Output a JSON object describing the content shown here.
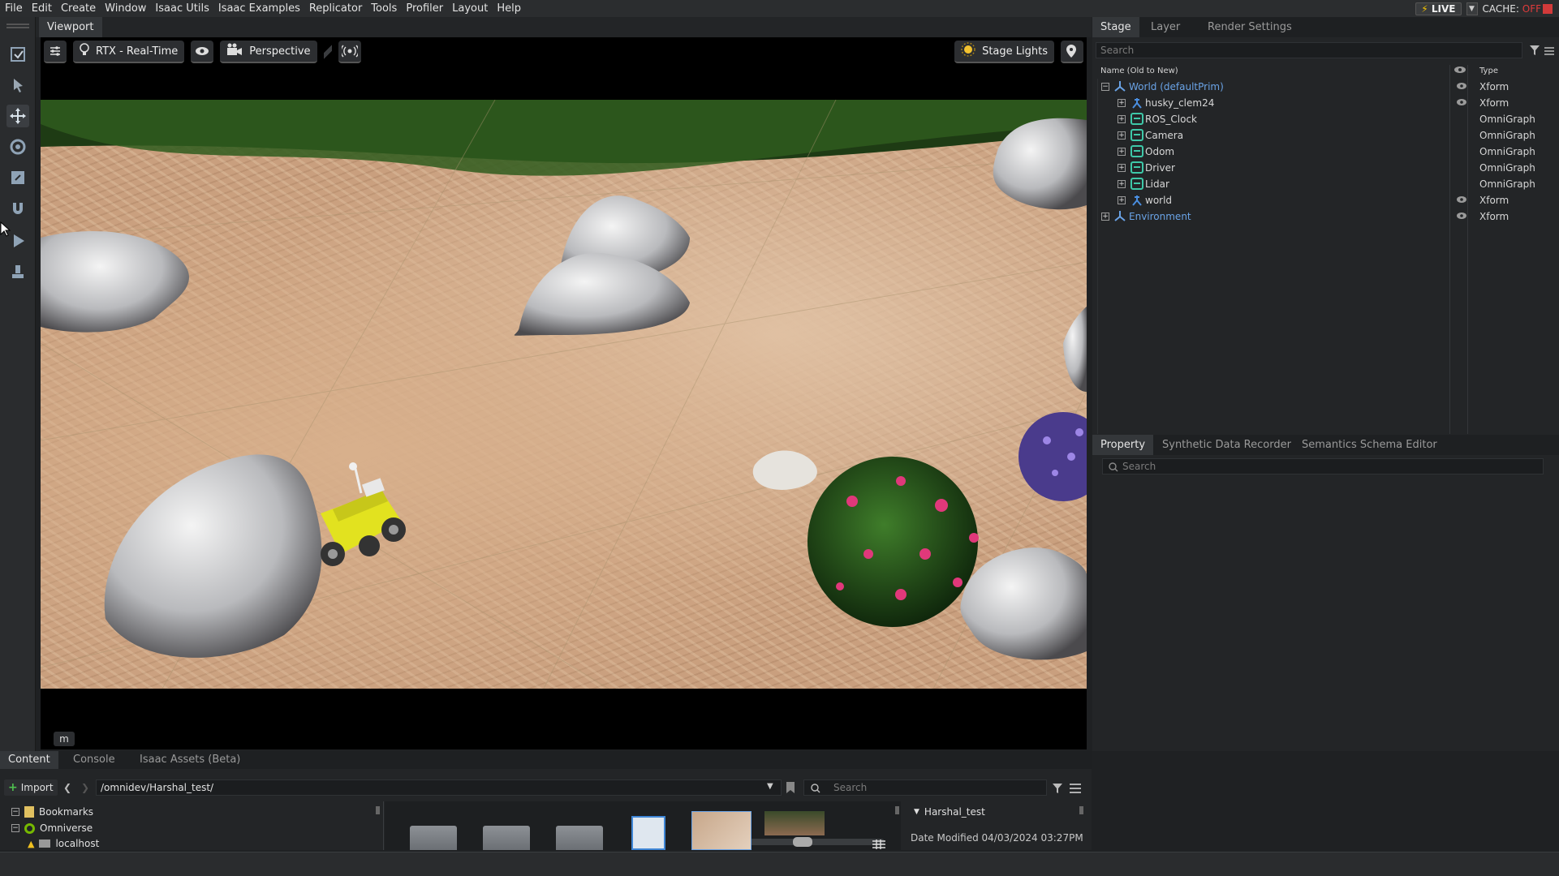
{
  "menu": [
    "File",
    "Edit",
    "Create",
    "Window",
    "Isaac Utils",
    "Isaac Examples",
    "Replicator",
    "Tools",
    "Profiler",
    "Layout",
    "Help"
  ],
  "live_label": "LIVE",
  "cache": {
    "label": "CACHE:",
    "state": "OFF"
  },
  "viewport": {
    "tab": "Viewport",
    "renderer": "RTX - Real-Time",
    "camera": "Perspective",
    "lights": "Stage Lights",
    "corner_label": "m"
  },
  "right_tabs": [
    "Stage",
    "Layer",
    "Render Settings"
  ],
  "stage": {
    "search_placeholder": "Search",
    "col_name": "Name (Old to New)",
    "col_type": "Type",
    "rows": [
      {
        "name": "World (defaultPrim)",
        "type": "Xform"
      },
      {
        "name": "husky_clem24",
        "type": "Xform"
      },
      {
        "name": "ROS_Clock",
        "type": "OmniGraph"
      },
      {
        "name": "Camera",
        "type": "OmniGraph"
      },
      {
        "name": "Odom",
        "type": "OmniGraph"
      },
      {
        "name": "Driver",
        "type": "OmniGraph"
      },
      {
        "name": "Lidar",
        "type": "OmniGraph"
      },
      {
        "name": "world",
        "type": "Xform"
      },
      {
        "name": "Environment",
        "type": "Xform"
      }
    ]
  },
  "property_tabs": [
    "Property",
    "Synthetic Data Recorder",
    "Semantics Schema Editor"
  ],
  "property_search": "Search",
  "content": {
    "tabs": [
      "Content",
      "Console",
      "Isaac Assets (Beta)"
    ],
    "import_label": "Import",
    "path": "/omnidev/Harshal_test/",
    "search_placeholder": "Search",
    "tree": [
      "Bookmarks",
      "Omniverse",
      "localhost"
    ],
    "detail_title": "Harshal_test",
    "detail_modified": "Date Modified 04/03/2024 03:27PM"
  },
  "colors": {
    "accent": "#6aa3e6",
    "graph": "#3ec8a8",
    "cache_off": "#e03b3b"
  }
}
